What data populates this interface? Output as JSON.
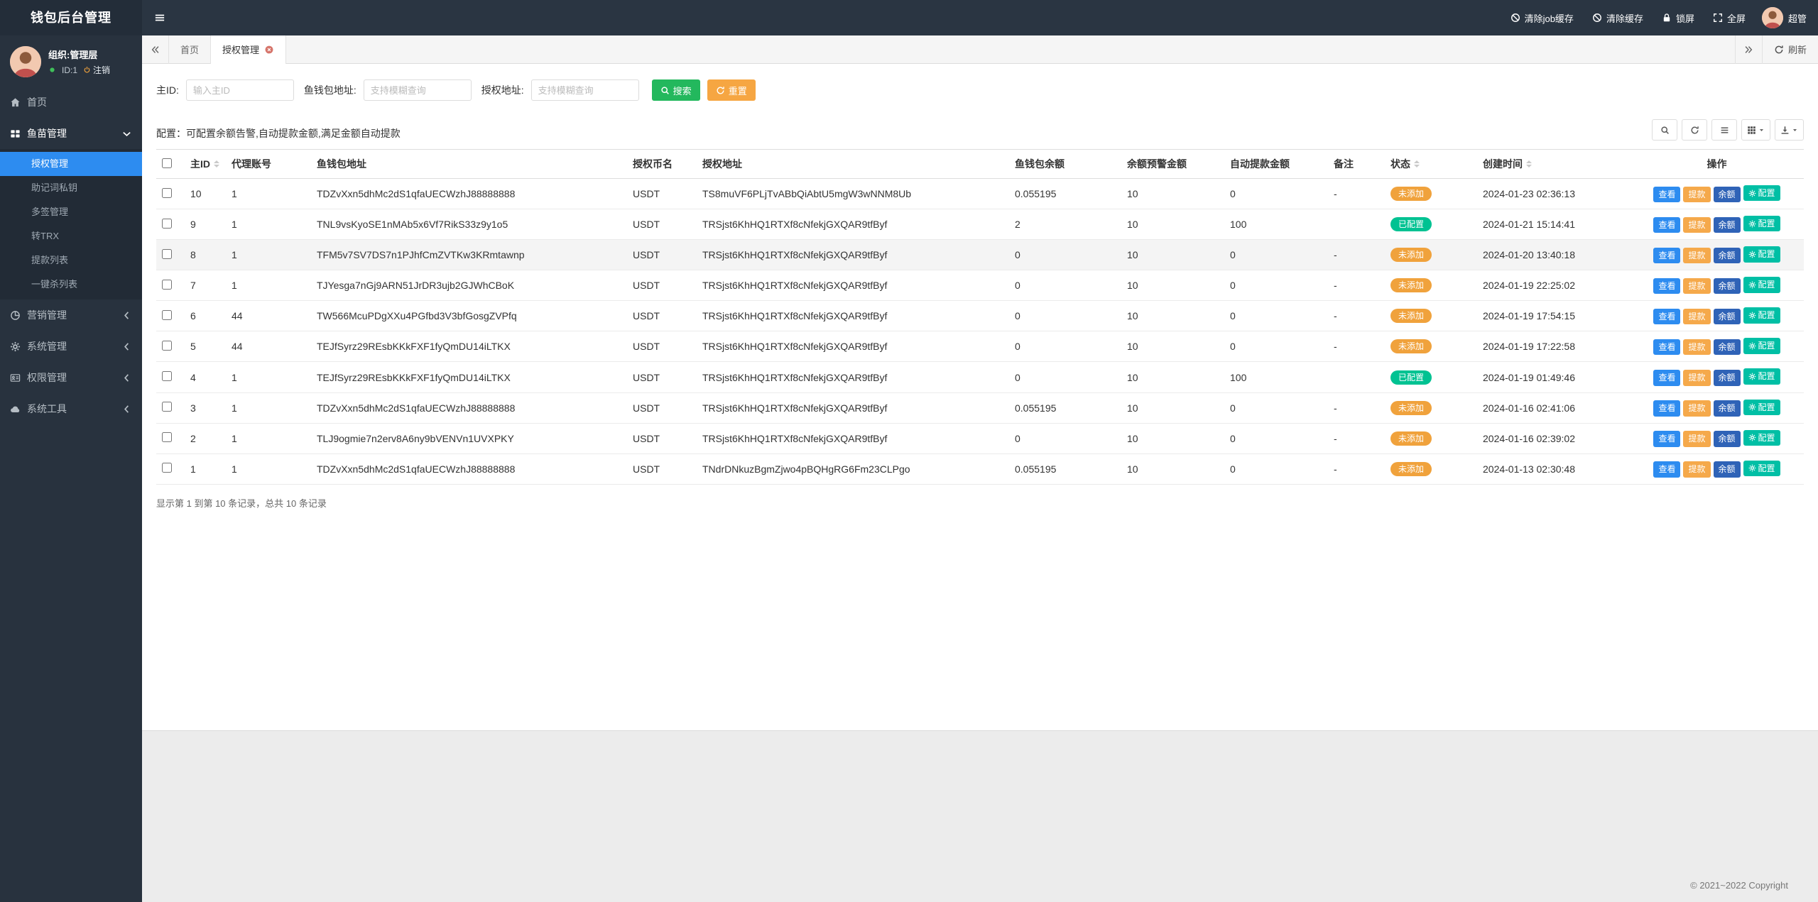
{
  "app": {
    "title": "钱包后台管理",
    "copyright": "© 2021~2022 Copyright"
  },
  "header": {
    "actions": [
      {
        "label": "清除job缓存",
        "icon": "ban-icon"
      },
      {
        "label": "清除缓存",
        "icon": "ban-icon"
      },
      {
        "label": "锁屏",
        "icon": "lock-icon"
      },
      {
        "label": "全屏",
        "icon": "fullscreen-icon"
      }
    ],
    "user_name": "超管"
  },
  "sidebar": {
    "profile": {
      "org_label": "组织:管理层",
      "id_label": "ID:1",
      "logout_label": "注销"
    },
    "menu": [
      {
        "label": "首页",
        "icon": "home-icon"
      },
      {
        "label": "鱼苗管理",
        "icon": "grid-icon",
        "expanded": true,
        "children": [
          {
            "label": "授权管理",
            "active": true
          },
          {
            "label": "助记词私钥"
          },
          {
            "label": "多签管理"
          },
          {
            "label": "转TRX"
          },
          {
            "label": "提款列表"
          },
          {
            "label": "一键杀列表"
          }
        ]
      },
      {
        "label": "营销管理",
        "icon": "chart-icon",
        "children": []
      },
      {
        "label": "系统管理",
        "icon": "gear-icon",
        "children": []
      },
      {
        "label": "权限管理",
        "icon": "idcard-icon",
        "children": []
      },
      {
        "label": "系统工具",
        "icon": "cloud-icon",
        "children": []
      }
    ]
  },
  "tabs": {
    "items": [
      {
        "label": "首页",
        "active": false,
        "closable": false
      },
      {
        "label": "授权管理",
        "active": true,
        "closable": true
      }
    ],
    "refresh_label": "刷新"
  },
  "filters": {
    "fields": [
      {
        "label": "主ID:",
        "placeholder": "输入主ID",
        "value": ""
      },
      {
        "label": "鱼钱包地址:",
        "placeholder": "支持模糊查询",
        "value": ""
      },
      {
        "label": "授权地址:",
        "placeholder": "支持模糊查询",
        "value": ""
      }
    ],
    "search_label": "搜索",
    "reset_label": "重置"
  },
  "config_note": "配置：可配置余额告警,自动提款金额,满足金额自动提款",
  "toolbar": {
    "buttons": [
      {
        "icon": "search-icon",
        "name": "toggle-search-button",
        "caret": false
      },
      {
        "icon": "refresh-icon",
        "name": "refresh-table-button",
        "caret": false
      },
      {
        "icon": "list-icon",
        "name": "toggle-view-button",
        "caret": false
      },
      {
        "icon": "columns-icon",
        "name": "columns-dropdown-button",
        "caret": true
      },
      {
        "icon": "download-icon",
        "name": "export-dropdown-button",
        "caret": true
      }
    ]
  },
  "table": {
    "columns": [
      {
        "label": "主ID",
        "sortable": true
      },
      {
        "label": "代理账号",
        "sortable": false
      },
      {
        "label": "鱼钱包地址",
        "sortable": false
      },
      {
        "label": "授权币名",
        "sortable": false
      },
      {
        "label": "授权地址",
        "sortable": false
      },
      {
        "label": "鱼钱包余额",
        "sortable": false
      },
      {
        "label": "余额预警金额",
        "sortable": false
      },
      {
        "label": "自动提款金额",
        "sortable": false
      },
      {
        "label": "备注",
        "sortable": false
      },
      {
        "label": "状态",
        "sortable": true
      },
      {
        "label": "创建时间",
        "sortable": true
      },
      {
        "label": "操作",
        "sortable": false
      }
    ],
    "actions": [
      {
        "label": "查看",
        "style": "view"
      },
      {
        "label": "提款",
        "style": "withdraw"
      },
      {
        "label": "余额",
        "style": "balance"
      },
      {
        "label": "配置",
        "style": "config",
        "icon": "gear-icon"
      }
    ],
    "rows": [
      {
        "id": "10",
        "agent": "1",
        "wallet_address": "TDZvXxn5dhMc2dS1qfaUECWzhJ88888888",
        "coin": "USDT",
        "auth_address": "TS8muVF6PLjTvABbQiAbtU5mgW3wNNM8Ub",
        "balance": "0.055195",
        "warn_amount": "10",
        "auto_amount": "0",
        "remark": "-",
        "status": "未添加",
        "status_style": "not_added",
        "created_at": "2024-01-23 02:36:13",
        "highlighted": false
      },
      {
        "id": "9",
        "agent": "1",
        "wallet_address": "TNL9vsKyoSE1nMAb5x6Vf7RikS33z9y1o5",
        "coin": "USDT",
        "auth_address": "TRSjst6KhHQ1RTXf8cNfekjGXQAR9tfByf",
        "balance": "2",
        "warn_amount": "10",
        "auto_amount": "100",
        "remark": "",
        "status": "已配置",
        "status_style": "added",
        "created_at": "2024-01-21 15:14:41",
        "highlighted": false
      },
      {
        "id": "8",
        "agent": "1",
        "wallet_address": "TFM5v7SV7DS7n1PJhfCmZVTKw3KRmtawnp",
        "coin": "USDT",
        "auth_address": "TRSjst6KhHQ1RTXf8cNfekjGXQAR9tfByf",
        "balance": "0",
        "warn_amount": "10",
        "auto_amount": "0",
        "remark": "-",
        "status": "未添加",
        "status_style": "not_added",
        "created_at": "2024-01-20 13:40:18",
        "highlighted": true
      },
      {
        "id": "7",
        "agent": "1",
        "wallet_address": "TJYesga7nGj9ARN51JrDR3ujb2GJWhCBoK",
        "coin": "USDT",
        "auth_address": "TRSjst6KhHQ1RTXf8cNfekjGXQAR9tfByf",
        "balance": "0",
        "warn_amount": "10",
        "auto_amount": "0",
        "remark": "-",
        "status": "未添加",
        "status_style": "not_added",
        "created_at": "2024-01-19 22:25:02",
        "highlighted": false
      },
      {
        "id": "6",
        "agent": "44",
        "wallet_address": "TW566McuPDgXXu4PGfbd3V3bfGosgZVPfq",
        "coin": "USDT",
        "auth_address": "TRSjst6KhHQ1RTXf8cNfekjGXQAR9tfByf",
        "balance": "0",
        "warn_amount": "10",
        "auto_amount": "0",
        "remark": "-",
        "status": "未添加",
        "status_style": "not_added",
        "created_at": "2024-01-19 17:54:15",
        "highlighted": false
      },
      {
        "id": "5",
        "agent": "44",
        "wallet_address": "TEJfSyrz29REsbKKkFXF1fyQmDU14iLTKX",
        "coin": "USDT",
        "auth_address": "TRSjst6KhHQ1RTXf8cNfekjGXQAR9tfByf",
        "balance": "0",
        "warn_amount": "10",
        "auto_amount": "0",
        "remark": "-",
        "status": "未添加",
        "status_style": "not_added",
        "created_at": "2024-01-19 17:22:58",
        "highlighted": false
      },
      {
        "id": "4",
        "agent": "1",
        "wallet_address": "TEJfSyrz29REsbKKkFXF1fyQmDU14iLTKX",
        "coin": "USDT",
        "auth_address": "TRSjst6KhHQ1RTXf8cNfekjGXQAR9tfByf",
        "balance": "0",
        "warn_amount": "10",
        "auto_amount": "100",
        "remark": "",
        "status": "已配置",
        "status_style": "added",
        "created_at": "2024-01-19 01:49:46",
        "highlighted": false
      },
      {
        "id": "3",
        "agent": "1",
        "wallet_address": "TDZvXxn5dhMc2dS1qfaUECWzhJ88888888",
        "coin": "USDT",
        "auth_address": "TRSjst6KhHQ1RTXf8cNfekjGXQAR9tfByf",
        "balance": "0.055195",
        "warn_amount": "10",
        "auto_amount": "0",
        "remark": "-",
        "status": "未添加",
        "status_style": "not_added",
        "created_at": "2024-01-16 02:41:06",
        "highlighted": false
      },
      {
        "id": "2",
        "agent": "1",
        "wallet_address": "TLJ9ogmie7n2erv8A6ny9bVENVn1UVXPKY",
        "coin": "USDT",
        "auth_address": "TRSjst6KhHQ1RTXf8cNfekjGXQAR9tfByf",
        "balance": "0",
        "warn_amount": "10",
        "auto_amount": "0",
        "remark": "-",
        "status": "未添加",
        "status_style": "not_added",
        "created_at": "2024-01-16 02:39:02",
        "highlighted": false
      },
      {
        "id": "1",
        "agent": "1",
        "wallet_address": "TDZvXxn5dhMc2dS1qfaUECWzhJ88888888",
        "coin": "USDT",
        "auth_address": "TNdrDNkuzBgmZjwo4pBQHgRG6Fm23CLPgo",
        "balance": "0.055195",
        "warn_amount": "10",
        "auto_amount": "0",
        "remark": "-",
        "status": "未添加",
        "status_style": "not_added",
        "created_at": "2024-01-13 02:30:48",
        "highlighted": false
      }
    ]
  },
  "pagination": {
    "summary": "显示第 1 到第 10 条记录，总共 10 条记录"
  },
  "colors": {
    "accent_blue": "#2d8cf0",
    "success_green": "#23b85d",
    "warning_orange": "#f0a23c",
    "teal": "#00bfa5",
    "badge_added": "#00c292",
    "badge_not_added": "#f0a23c",
    "topbar_bg": "#2a3542",
    "sidebar_bg": "#28323e"
  }
}
